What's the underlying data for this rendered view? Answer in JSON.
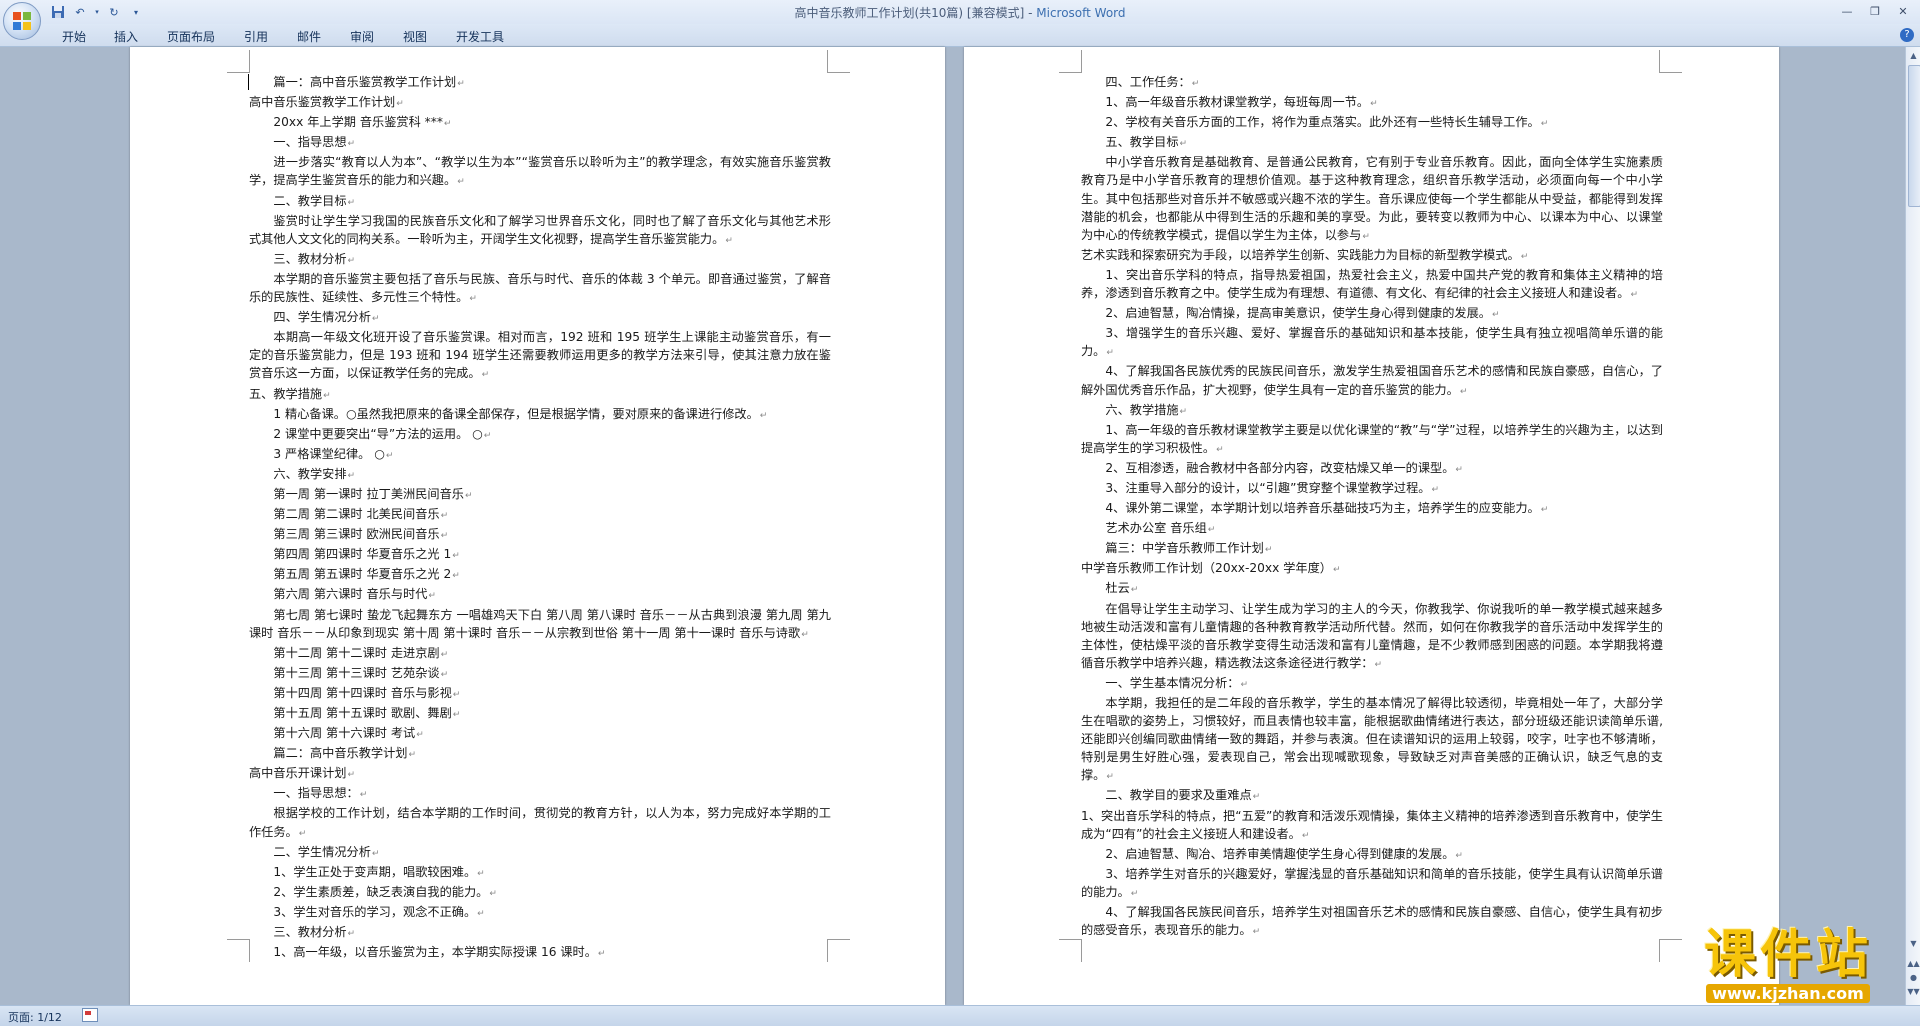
{
  "window": {
    "title_doc": "高中音乐教师工作计划(共10篇) [兼容模式] - ",
    "title_app": "Microsoft Word"
  },
  "ribbon": {
    "tabs": [
      "开始",
      "插入",
      "页面布局",
      "引用",
      "邮件",
      "审阅",
      "视图",
      "开发工具"
    ]
  },
  "status": {
    "page_info": "页面: 1/12"
  },
  "watermark": {
    "brand": "课件站",
    "url": "www.kjzhan.com"
  },
  "page1": {
    "paragraphs": [
      {
        "t": "篇一：高中音乐鉴赏教学工作计划",
        "i": 1
      },
      {
        "t": "高中音乐鉴赏教学工作计划",
        "i": 0
      },
      {
        "t": "20xx 年上学期  音乐鉴赏科  ***",
        "i": 1
      },
      {
        "t": "一、指导思想",
        "i": 1
      },
      {
        "t": "进一步落实“教育以人为本”、“教学以生为本”“鉴赏音乐以聆听为主”的教学理念，有效实施音乐鉴赏教学，提高学生鉴赏音乐的能力和兴趣。",
        "i": 1
      },
      {
        "t": "二、教学目标",
        "i": 1
      },
      {
        "t": "鉴赏时让学生学习我国的民族音乐文化和了解学习世界音乐文化，同时也了解了音乐文化与其他艺术形式其他人文文化的同构关系。一聆听为主，开阔学生文化视野，提高学生音乐鉴赏能力。",
        "i": 1
      },
      {
        "t": "三、教材分析",
        "i": 1
      },
      {
        "t": "本学期的音乐鉴赏主要包括了音乐与民族、音乐与时代、音乐的体裁 3 个单元。即音通过鉴赏，了解音乐的民族性、延续性、多元性三个特性。",
        "i": 1
      },
      {
        "t": "四、学生情况分析",
        "i": 1
      },
      {
        "t": "本期高一年级文化班开设了音乐鉴赏课。相对而言，192 班和 195 班学生上课能主动鉴赏音乐，有一定的音乐鉴赏能力，但是 193 班和 194 班学生还需要教师运用更多的教学方法来引导，使其注意力放在鉴赏音乐这一方面，以保证教学任务的完成。",
        "i": 1
      },
      {
        "t": "五、教学措施",
        "i": 0
      },
      {
        "t": "1 精心备课。○虽然我把原来的备课全部保存，但是根据学情，要对原来的备课进行修改。",
        "i": 1
      },
      {
        "t": "2 课堂中更要突出“导”方法的运用。  ○",
        "i": 1
      },
      {
        "t": "3 严格课堂纪律。  ○",
        "i": 1
      },
      {
        "t": "六、教学安排",
        "i": 1
      },
      {
        "t": "第一周  第一课时  拉丁美洲民间音乐",
        "i": 1
      },
      {
        "t": "第二周  第二课时  北美民间音乐",
        "i": 1
      },
      {
        "t": "第三周  第三课时  欧洲民间音乐",
        "i": 1
      },
      {
        "t": "第四周  第四课时  华夏音乐之光 1",
        "i": 1
      },
      {
        "t": "第五周  第五课时  华夏音乐之光 2",
        "i": 1
      },
      {
        "t": "第六周  第六课时  音乐与时代",
        "i": 1
      },
      {
        "t": "第七周  第七课时  蛰龙飞起舞东方    一唱雄鸡天下白  第八周  第八课时  音乐－－从古典到浪漫  第九周  第九课时  音乐－－从印象到现实  第十周  第十课时  音乐－－从宗教到世俗  第十一周  第十一课时  音乐与诗歌",
        "i": 1
      },
      {
        "t": "第十二周  第十二课时  走进京剧",
        "i": 1
      },
      {
        "t": "第十三周  第十三课时  艺苑杂谈",
        "i": 1
      },
      {
        "t": "第十四周  第十四课时  音乐与影视",
        "i": 1
      },
      {
        "t": "第十五周  第十五课时  歌剧、舞剧",
        "i": 1
      },
      {
        "t": "第十六周  第十六课时  考试",
        "i": 1
      },
      {
        "t": "篇二：高中音乐教学计划",
        "i": 1
      },
      {
        "t": "高中音乐开课计划",
        "i": 0
      },
      {
        "t": "一、指导思想：",
        "i": 1
      },
      {
        "t": "根据学校的工作计划，结合本学期的工作时间，贯彻党的教育方针，以人为本，努力完成好本学期的工作任务。",
        "i": 1
      },
      {
        "t": "二、学生情况分析",
        "i": 1
      },
      {
        "t": "1、学生正处于变声期，唱歌较困难。",
        "i": 1
      },
      {
        "t": "2、学生素质差，缺乏表演自我的能力。",
        "i": 1
      },
      {
        "t": "3、学生对音乐的学习，观念不正确。",
        "i": 1
      },
      {
        "t": "三、教材分析",
        "i": 1
      },
      {
        "t": "1、高一年级，以音乐鉴赏为主，本学期实际授课 16 课时。",
        "i": 1
      }
    ]
  },
  "page2": {
    "paragraphs": [
      {
        "t": "四、工作任务：",
        "i": 1
      },
      {
        "t": "1、高一年级音乐教材课堂教学，每班每周一节。",
        "i": 1
      },
      {
        "t": "2、学校有关音乐方面的工作，将作为重点落实。此外还有一些特长生辅导工作。",
        "i": 1
      },
      {
        "t": "五、教学目标",
        "i": 1
      },
      {
        "t": "中小学音乐教育是基础教育、是普通公民教育，它有别于专业音乐教育。因此，面向全体学生实施素质教育乃是中小学音乐教育的理想价值观。基于这种教育理念，组织音乐教学活动，必须面向每一个中小学生。其中包括那些对音乐并不敏感或兴趣不浓的学生。音乐课应使每一个学生都能从中受益，都能得到发挥潜能的机会，也都能从中得到生活的乐趣和美的享受。为此，要转变以教师为中心、以课本为中心、以课堂为中心的传统教学模式，提倡以学生为主体，以参与",
        "i": 1
      },
      {
        "t": "艺术实践和探索研究为手段，以培养学生创新、实践能力为目标的新型教学模式。",
        "i": 0
      },
      {
        "t": "1、突出音乐学科的特点，指导热爱祖国，热爱社会主义，热爱中国共产党的教育和集体主义精神的培养，渗透到音乐教育之中。使学生成为有理想、有道德、有文化、有纪律的社会主义接班人和建设者。",
        "i": 1
      },
      {
        "t": "2、启迪智慧，陶冶情操，提高审美意识，使学生身心得到健康的发展。",
        "i": 1
      },
      {
        "t": "3、增强学生的音乐兴趣、爱好、掌握音乐的基础知识和基本技能，使学生具有独立视唱简单乐谱的能力。",
        "i": 1
      },
      {
        "t": "4、了解我国各民族优秀的民族民间音乐，激发学生热爱祖国音乐艺术的感情和民族自豪感，自信心，了解外国优秀音乐作品，扩大视野，使学生具有一定的音乐鉴赏的能力。",
        "i": 1
      },
      {
        "t": "六、教学措施",
        "i": 1
      },
      {
        "t": "1、高一年级的音乐教材课堂教学主要是以优化课堂的“教”与“学”过程，以培养学生的兴趣为主，以达到提高学生的学习积极性。",
        "i": 1
      },
      {
        "t": "2、互相渗透，融合教材中各部分内容，改变枯燥又单一的课型。",
        "i": 1
      },
      {
        "t": "3、注重导入部分的设计，以“引趣”贯穿整个课堂教学过程。",
        "i": 1
      },
      {
        "t": "4、课外第二课堂，本学期计划以培养音乐基础技巧为主，培养学生的应变能力。",
        "i": 1
      },
      {
        "t": "艺术办公室  音乐组",
        "i": 1
      },
      {
        "t": "篇三：中学音乐教师工作计划",
        "i": 1
      },
      {
        "t": "中学音乐教师工作计划（20xx-20xx 学年度）",
        "i": 0
      },
      {
        "t": "杜云",
        "i": 1
      },
      {
        "t": "在倡导让学生主动学习、让学生成为学习的主人的今天，你教我学、你说我听的单一教学模式越来越多地被生动活泼和富有儿童情趣的各种教育教学活动所代替。然而，如何在你教我学的音乐活动中发挥学生的主体性，使枯燥平淡的音乐教学变得生动活泼和富有儿童情趣，是不少教师感到困惑的问题。本学期我将遵循音乐教学中培养兴趣，精选教法这条途径进行教学：",
        "i": 1
      },
      {
        "t": "一、学生基本情况分析：",
        "i": 1
      },
      {
        "t": "本学期，我担任的是二年段的音乐教学，学生的基本情况了解得比较透彻，毕竟相处一年了，大部分学生在唱歌的姿势上，习惯较好，而且表情也较丰富，能根据歌曲情绪进行表达，部分班级还能识读简单乐谱,还能即兴创编同歌曲情绪一致的舞蹈，并参与表演。但在读谱知识的运用上较弱，咬字，吐字也不够清晰，特别是男生好胜心强，爱表现自己，常会出现喊歌现象，导致缺乏对声音美感的正确认识，缺乏气息的支撑。",
        "i": 1
      },
      {
        "t": "二、教学目的要求及重难点",
        "i": 1
      },
      {
        "t": "1、突出音乐学科的特点，把“五爱”的教育和活泼乐观情操，集体主义精神的培养渗透到音乐教育中，使学生成为“四有”的社会主义接班人和建设者。",
        "i": 0
      },
      {
        "t": "2、启迪智慧、陶冶、培养审美情趣使学生身心得到健康的发展。",
        "i": 1
      },
      {
        "t": "3、培养学生对音乐的兴趣爱好，掌握浅显的音乐基础知识和简单的音乐技能，使学生具有认识简单乐谱的能力。",
        "i": 1
      },
      {
        "t": "4、了解我国各民族民间音乐，培养学生对祖国音乐艺术的感情和民族自豪感、自信心，使学生具有初步的感受音乐，表现音乐的能力。",
        "i": 1
      }
    ]
  }
}
